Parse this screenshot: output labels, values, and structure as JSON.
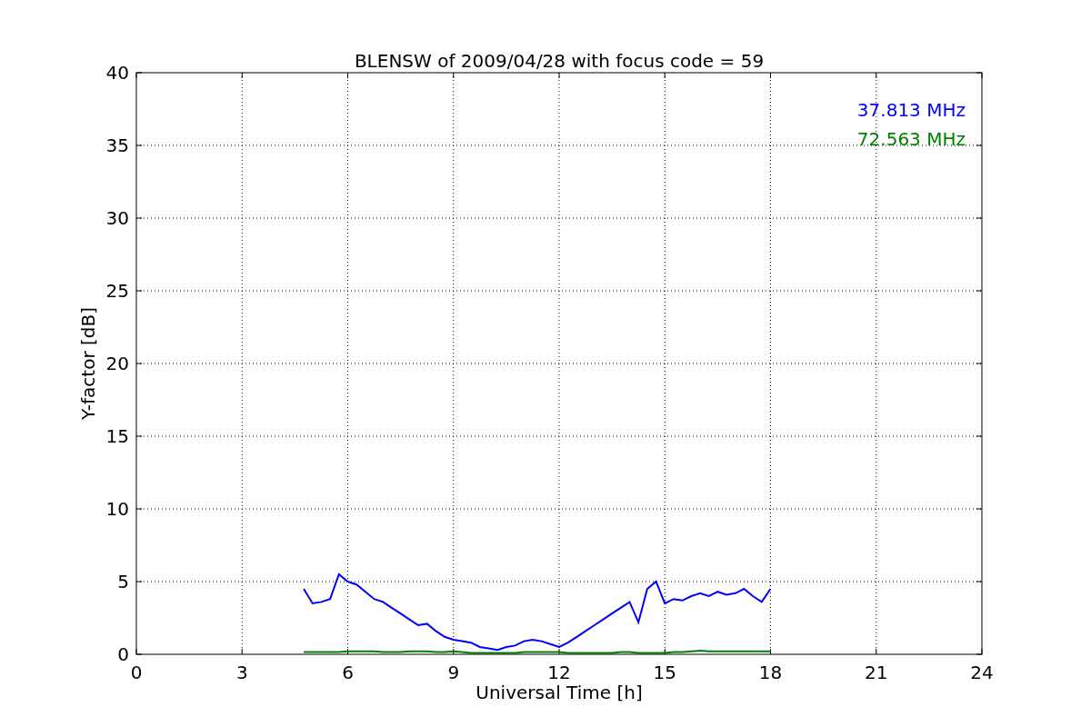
{
  "chart_data": {
    "type": "line",
    "title": "BLENSW of 2009/04/28 with focus code = 59",
    "xlabel": "Universal Time [h]",
    "ylabel": "Y-factor [dB]",
    "x": [
      4.75,
      5,
      5.25,
      5.5,
      5.75,
      6,
      6.25,
      6.5,
      6.75,
      7,
      7.25,
      7.5,
      7.75,
      8,
      8.25,
      8.5,
      8.75,
      9,
      9.25,
      9.5,
      9.75,
      10,
      10.25,
      10.5,
      10.75,
      11,
      11.25,
      11.5,
      11.75,
      12,
      12.25,
      12.5,
      12.75,
      13,
      13.25,
      13.5,
      13.75,
      14,
      14.25,
      14.5,
      14.75,
      15,
      15.25,
      15.5,
      15.75,
      16,
      16.25,
      16.5,
      16.75,
      17,
      17.25,
      17.5,
      17.75,
      18
    ],
    "series": [
      {
        "name": "37.813 MHz",
        "color": "#0000ff",
        "values": [
          4.5,
          3.5,
          3.6,
          3.8,
          5.5,
          5.0,
          4.8,
          4.3,
          3.8,
          3.6,
          3.2,
          2.8,
          2.4,
          2.0,
          2.1,
          1.6,
          1.2,
          1.0,
          0.9,
          0.8,
          0.5,
          0.4,
          0.3,
          0.5,
          0.6,
          0.9,
          1.0,
          0.9,
          0.7,
          0.5,
          0.8,
          1.2,
          1.6,
          2.0,
          2.4,
          2.8,
          3.2,
          3.6,
          2.2,
          4.5,
          5.0,
          3.5,
          3.8,
          3.7,
          4.0,
          4.2,
          4.0,
          4.3,
          4.1,
          4.2,
          4.5,
          4.0,
          3.6,
          4.5
        ]
      },
      {
        "name": "72.563 MHz",
        "color": "#008000",
        "values": [
          0.15,
          0.15,
          0.15,
          0.15,
          0.15,
          0.2,
          0.2,
          0.2,
          0.2,
          0.15,
          0.15,
          0.15,
          0.2,
          0.2,
          0.2,
          0.15,
          0.15,
          0.2,
          0.15,
          0.1,
          0.1,
          0.1,
          0.1,
          0.1,
          0.1,
          0.15,
          0.15,
          0.15,
          0.15,
          0.15,
          0.1,
          0.1,
          0.1,
          0.1,
          0.1,
          0.1,
          0.15,
          0.15,
          0.1,
          0.1,
          0.1,
          0.1,
          0.15,
          0.15,
          0.2,
          0.25,
          0.2,
          0.2,
          0.2,
          0.2,
          0.2,
          0.2,
          0.2,
          0.2
        ]
      }
    ],
    "xlim": [
      0,
      24
    ],
    "ylim": [
      0,
      40
    ],
    "xticks": [
      0,
      3,
      6,
      9,
      12,
      15,
      18,
      21,
      24
    ],
    "yticks": [
      0,
      5,
      10,
      15,
      20,
      25,
      30,
      35,
      40
    ],
    "grid": true
  }
}
